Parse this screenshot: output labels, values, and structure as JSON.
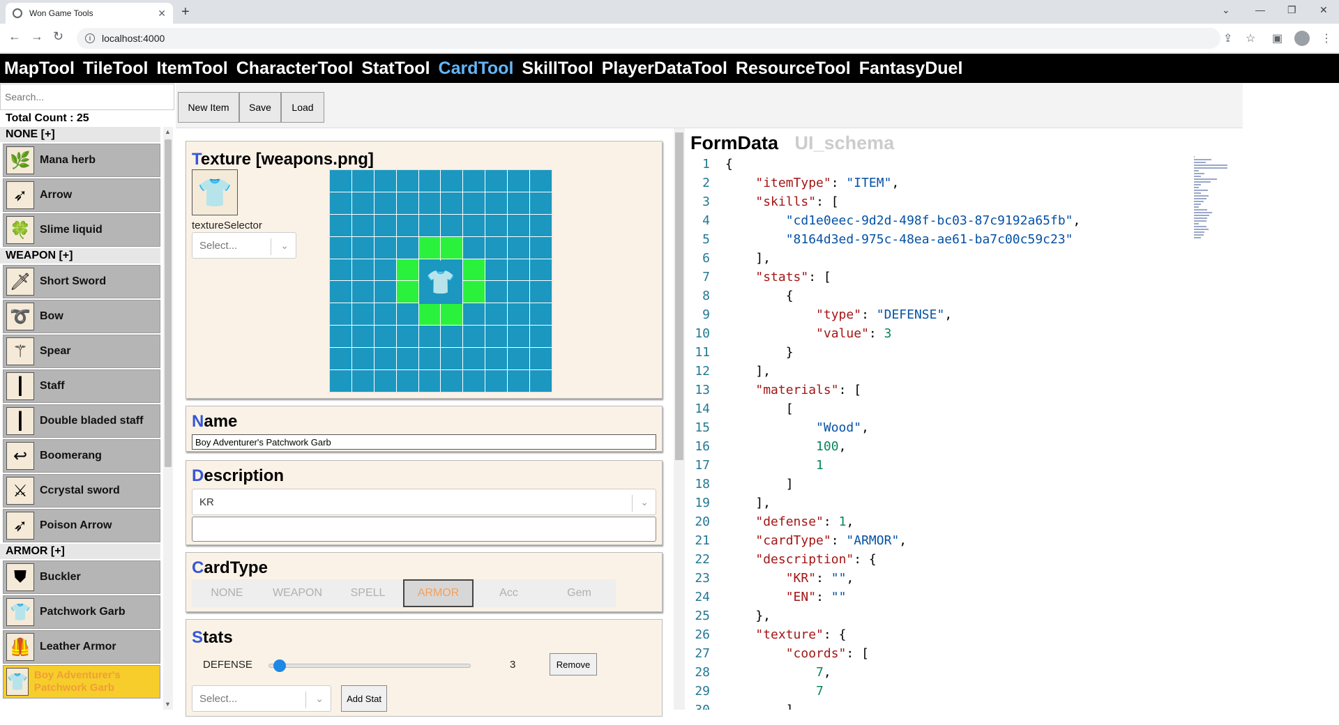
{
  "browser": {
    "tab_title": "Won Game Tools",
    "url": "localhost:4000",
    "new_tab": "+",
    "tab_close": "✕"
  },
  "nav": [
    "MapTool",
    "TileTool",
    "ItemTool",
    "CharacterTool",
    "StatTool",
    "CardTool",
    "SkillTool",
    "PlayerDataTool",
    "ResourceTool",
    "FantasyDuel"
  ],
  "nav_active": "CardTool",
  "sidebar": {
    "search_placeholder": "Search...",
    "total_count": "Total Count : 25",
    "categories": [
      {
        "header": "NONE  [+]",
        "items": [
          "Mana herb",
          "Arrow",
          "Slime liquid"
        ]
      },
      {
        "header": "WEAPON  [+]",
        "items": [
          "Short Sword",
          "Bow",
          "Spear",
          "Staff",
          "Double bladed staff",
          "Boomerang",
          "Ccrystal sword",
          "Poison Arrow"
        ]
      },
      {
        "header": "ARMOR  [+]",
        "items": [
          "Buckler",
          "Patchwork Garb",
          "Leather Armor",
          "Boy Adventurer's Patchwork Garb"
        ]
      }
    ],
    "selected_item": "Boy Adventurer's Patchwork Garb"
  },
  "buttons": {
    "new_item": "New Item",
    "save": "Save",
    "load": "Load"
  },
  "texture": {
    "title_first": "T",
    "title_rest": "exture [weapons.png]",
    "selector_label": "textureSelector",
    "selector_placeholder": "Select..."
  },
  "name": {
    "title_first": "N",
    "title_rest": "ame",
    "value": "Boy Adventurer's Patchwork Garb"
  },
  "description": {
    "title_first": "D",
    "title_rest": "escription",
    "lang": "KR",
    "value": ""
  },
  "card_type": {
    "title_first": "C",
    "title_rest": "ardType",
    "options": [
      "NONE",
      "WEAPON",
      "SPELL",
      "ARMOR",
      "Acc",
      "Gem"
    ],
    "selected": "ARMOR"
  },
  "stats": {
    "title_first": "S",
    "title_rest": "tats",
    "rows": [
      {
        "type": "DEFENSE",
        "value": "3",
        "fraction": 0.02,
        "remove_label": "Remove"
      }
    ],
    "select_placeholder": "Select...",
    "add_label": "Add Stat"
  },
  "editor": {
    "tab_formdata": "FormData",
    "tab_uischema": "UI_schema",
    "lines": [
      "{",
      "    \"itemType\": \"ITEM\",",
      "    \"skills\": [",
      "        \"cd1e0eec-9d2d-498f-bc03-87c9192a65fb\",",
      "        \"8164d3ed-975c-48ea-ae61-ba7c00c59c23\"",
      "    ],",
      "    \"stats\": [",
      "        {",
      "            \"type\": \"DEFENSE\",",
      "            \"value\": 3",
      "        }",
      "    ],",
      "    \"materials\": [",
      "        [",
      "            \"Wood\",",
      "            100,",
      "            1",
      "        ]",
      "    ],",
      "    \"defense\": 1,",
      "    \"cardType\": \"ARMOR\",",
      "    \"description\": {",
      "        \"KR\": \"\",",
      "        \"EN\": \"\"",
      "    },",
      "    \"texture\": {",
      "        \"coords\": [",
      "            7,",
      "            7",
      "        ]"
    ]
  }
}
